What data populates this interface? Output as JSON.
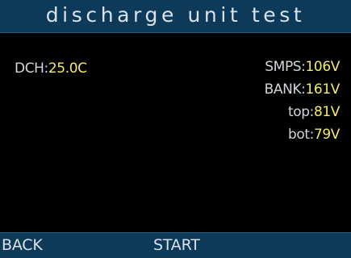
{
  "header": {
    "title": "discharge unit test"
  },
  "main": {
    "dch": {
      "label": "DCH:",
      "value": "25.0C"
    },
    "readings": [
      {
        "label": "SMPS:",
        "value": "106V"
      },
      {
        "label": "BANK:",
        "value": "161V"
      },
      {
        "label": "top:",
        "value": "81V"
      },
      {
        "label": "bot:",
        "value": "79V"
      }
    ]
  },
  "softkeys": {
    "back_label": "BACK",
    "start_label": "START"
  },
  "colors": {
    "bar_background": "#0e3a5a",
    "screen_background": "#000000",
    "label_text": "#d2d6da",
    "value_text": "#f4e96a"
  }
}
